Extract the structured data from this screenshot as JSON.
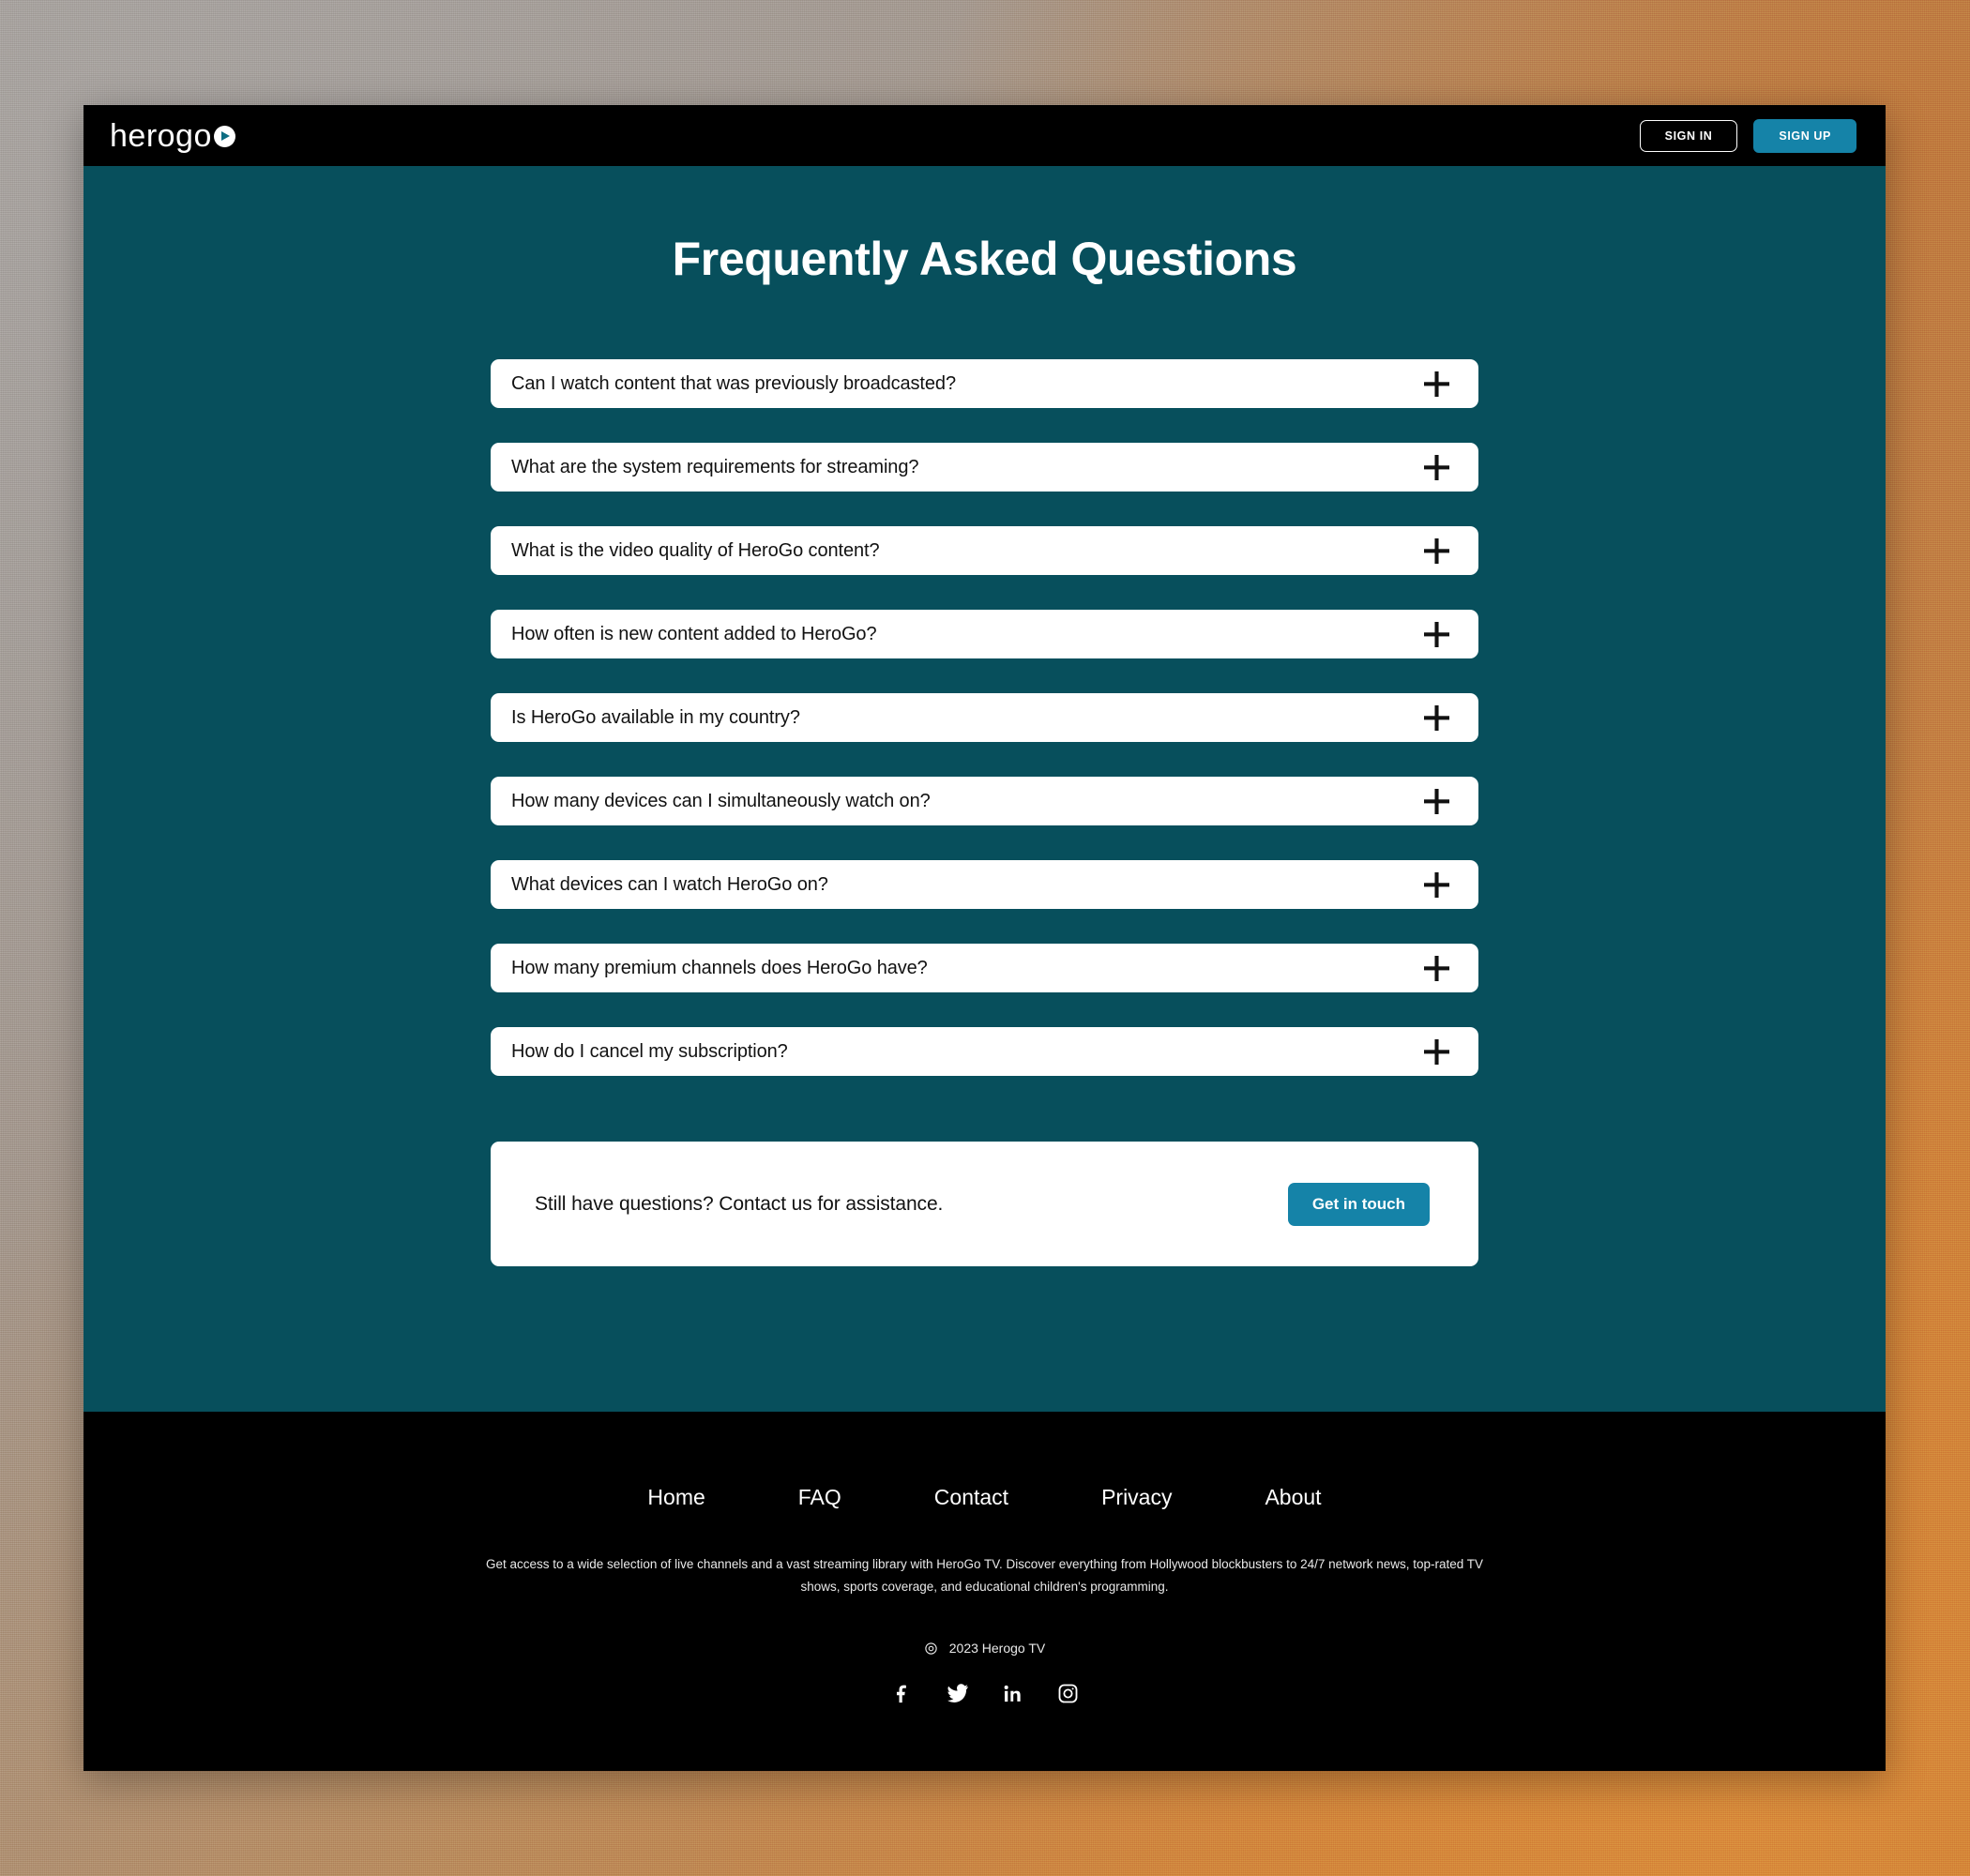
{
  "brand": {
    "logo_text": "herogo",
    "logo_mark": "play-circle-icon"
  },
  "colors": {
    "teal": "#074F5C",
    "blue_accent": "#1583A8",
    "black": "#000000",
    "card_white": "#FFFFFF"
  },
  "topbar": {
    "sign_in_label": "SIGN IN",
    "sign_up_label": "SIGN UP"
  },
  "main": {
    "title": "Frequently Asked Questions",
    "faq_items": [
      {
        "question": "Can I watch content that was previously broadcasted?",
        "toggle": "plus-icon"
      },
      {
        "question": "What are the system requirements for streaming?",
        "toggle": "plus-icon"
      },
      {
        "question": "What is the video quality of HeroGo content?",
        "toggle": "plus-icon"
      },
      {
        "question": "How often is new content added to HeroGo?",
        "toggle": "plus-icon"
      },
      {
        "question": "Is HeroGo available in my country?",
        "toggle": "plus-icon"
      },
      {
        "question": "How many devices can I simultaneously watch on?",
        "toggle": "plus-icon"
      },
      {
        "question": "What devices can I watch HeroGo on?",
        "toggle": "plus-icon"
      },
      {
        "question": "How many premium channels does HeroGo have?",
        "toggle": "plus-icon"
      },
      {
        "question": "How do I cancel my subscription?",
        "toggle": "plus-icon"
      }
    ],
    "contact": {
      "text": "Still have questions? Contact us for assistance.",
      "button_label": "Get in touch"
    }
  },
  "footer": {
    "links": [
      {
        "label": "Home"
      },
      {
        "label": "FAQ"
      },
      {
        "label": "Contact"
      },
      {
        "label": "Privacy"
      },
      {
        "label": "About"
      }
    ],
    "description": "Get access to a wide selection of live channels and a vast streaming library with HeroGo TV.  Discover everything from Hollywood blockbusters to 24/7 network news, top-rated TV shows, sports coverage, and educational children's programming.",
    "copyright_symbol": "©",
    "copyright_text": "2023 Herogo TV",
    "socials": [
      {
        "name": "facebook-icon"
      },
      {
        "name": "twitter-icon"
      },
      {
        "name": "linkedin-icon"
      },
      {
        "name": "instagram-icon"
      }
    ]
  }
}
